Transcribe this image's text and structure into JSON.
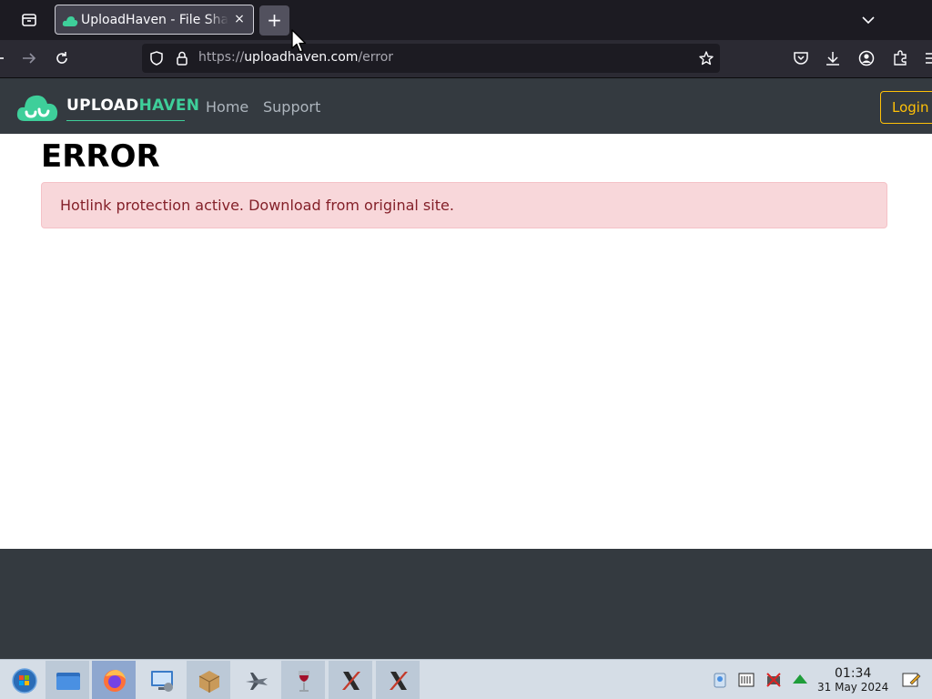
{
  "browser": {
    "tab": {
      "title": "UploadHaven - File Sharing",
      "close_label": "×",
      "favicon": "cloud-icon"
    },
    "new_tab_label": "+",
    "url": {
      "scheme": "https://",
      "host": "uploadhaven.com",
      "path": "/error"
    },
    "icons": [
      "tab-list-icon",
      "back-icon",
      "forward-icon",
      "reload-icon",
      "shield-icon",
      "lock-icon",
      "bookmark-star-icon",
      "pocket-icon",
      "download-icon",
      "account-icon",
      "extensions-icon",
      "menu-icon"
    ]
  },
  "site": {
    "brand": {
      "part1": "UPLOAD",
      "part2": "HAVEN"
    },
    "nav": [
      {
        "label": "Home"
      },
      {
        "label": "Support"
      }
    ],
    "login_label": "Login",
    "colors": {
      "header": "#343a40",
      "accent": "#3ecf9a",
      "login": "#ffc107"
    }
  },
  "content": {
    "heading": "ERROR",
    "alert": "Hotlink protection active. Download from original site.",
    "alert_colors": {
      "background": "#f8d7da",
      "text": "#842029"
    }
  },
  "taskbar": {
    "apps": [
      "start-orb-icon",
      "file-manager-icon",
      "firefox-icon",
      "system-settings-icon",
      "package-icon",
      "airplane-icon",
      "wine-icon",
      "x-app-icon",
      "x-app-icon-2"
    ],
    "tray": [
      "clipboard-icon",
      "battery-icon",
      "network-muted-icon",
      "update-arrow-icon",
      "notes-icon"
    ],
    "time": "01:34",
    "date": "31 May 2024"
  }
}
